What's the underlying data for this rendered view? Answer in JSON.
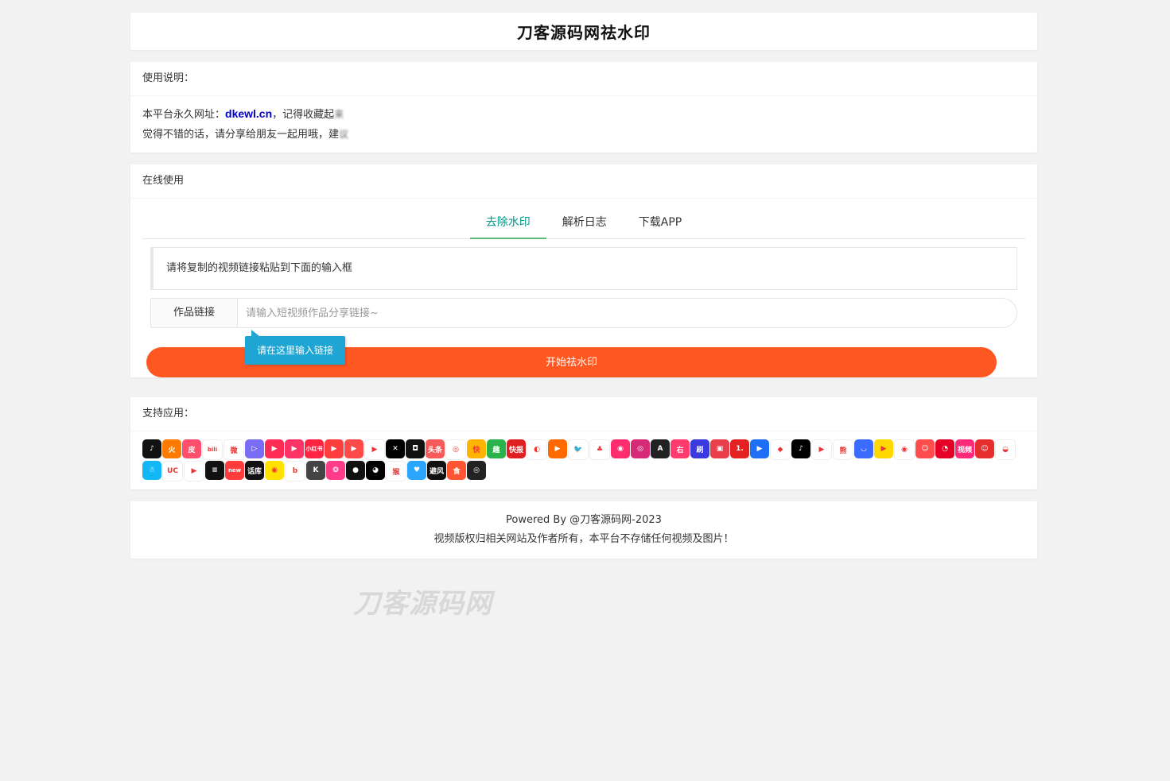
{
  "header": {
    "title": "刀客源码网祛水印"
  },
  "usage": {
    "heading": "使用说明：",
    "line1_prefix": "本平台永久网址：",
    "domain": "dkewl.cn",
    "line1_mid": "，记得收藏起",
    "line1_blur": "来",
    "line2_prefix": "觉得不错的话，请分享给朋友一起用哦，建",
    "line2_blur": "议"
  },
  "online": {
    "heading": "在线使用",
    "tabs": [
      {
        "label": "去除水印",
        "active": true
      },
      {
        "label": "解析日志",
        "active": false
      },
      {
        "label": "下载APP",
        "active": false
      }
    ],
    "notice": "请将复制的视频链接粘贴到下面的输入框",
    "input_label": "作品链接",
    "input_placeholder": "请输入短视频作品分享链接~",
    "input_value": "",
    "tooltip": "请在这里输入链接",
    "submit_label": "开始祛水印"
  },
  "supported": {
    "heading": "支持应用：",
    "icons": [
      {
        "name": "douyin-icon",
        "color": "#111111",
        "glyph": "♪"
      },
      {
        "name": "huoshan-icon",
        "color": "#ff7a00",
        "glyph": "火"
      },
      {
        "name": "pipixia-icon",
        "color": "#ff4f6d",
        "glyph": "皮"
      },
      {
        "name": "bilibili-icon",
        "color": "#ffffff",
        "glyph": "bili"
      },
      {
        "name": "weibo-icon",
        "color": "#ffffff",
        "glyph": "微"
      },
      {
        "name": "weishi-icon",
        "color": "#7b6cf6",
        "glyph": "▷"
      },
      {
        "name": "quanmin-icon",
        "color": "#ff2d55",
        "glyph": "▶"
      },
      {
        "name": "kuai-video-icon",
        "color": "#ff3366",
        "glyph": "▶"
      },
      {
        "name": "xiaohongshu-icon",
        "color": "#ff2442",
        "glyph": "小红书"
      },
      {
        "name": "haokan-icon",
        "color": "#ff3d3d",
        "glyph": "▶"
      },
      {
        "name": "xigua-icon",
        "color": "#ff4a4a",
        "glyph": "▶"
      },
      {
        "name": "youku-icon",
        "color": "#ffffff",
        "glyph": "▶"
      },
      {
        "name": "jianying-icon",
        "color": "#000000",
        "glyph": "✕"
      },
      {
        "name": "kuaishou-cam-icon",
        "color": "#111111",
        "glyph": "◘"
      },
      {
        "name": "toutiao-icon",
        "color": "#f85959",
        "glyph": "头条"
      },
      {
        "name": "meipai-icon",
        "color": "#ffffff",
        "glyph": "◎"
      },
      {
        "name": "kuai-icon",
        "color": "#ffb400",
        "glyph": "快"
      },
      {
        "name": "qutoutiao-icon",
        "color": "#2ab34a",
        "glyph": "趣"
      },
      {
        "name": "kuaibao-icon",
        "color": "#e02020",
        "glyph": "快报"
      },
      {
        "name": "weishi2-icon",
        "color": "#ffffff",
        "glyph": "◐"
      },
      {
        "name": "ku-video-icon",
        "color": "#ff6a00",
        "glyph": "▶"
      },
      {
        "name": "twitter-icon",
        "color": "#ffffff",
        "glyph": "🐦"
      },
      {
        "name": "lvzhou-icon",
        "color": "#ffffff",
        "glyph": "♣"
      },
      {
        "name": "momo-icon",
        "color": "#ff2d6f",
        "glyph": "◉"
      },
      {
        "name": "instagram-icon",
        "color": "#d62976",
        "glyph": "◎"
      },
      {
        "name": "acfun-icon",
        "color": "#222222",
        "glyph": "A"
      },
      {
        "name": "zuiyou-icon",
        "color": "#ff3a6e",
        "glyph": "右"
      },
      {
        "name": "shua-icon",
        "color": "#3a3adf",
        "glyph": "刷"
      },
      {
        "name": "mei-video-icon",
        "color": "#e93e4b",
        "glyph": "▣"
      },
      {
        "name": "yidian-icon",
        "color": "#e52222",
        "glyph": "1."
      },
      {
        "name": "play-icon",
        "color": "#1e6ff5",
        "glyph": "▶"
      },
      {
        "name": "aiqiyi-icon",
        "color": "#ffffff",
        "glyph": "◆"
      },
      {
        "name": "tiktok-icon",
        "color": "#000000",
        "glyph": "♪"
      },
      {
        "name": "youtube-icon",
        "color": "#ffffff",
        "glyph": "▶"
      },
      {
        "name": "panda-icon",
        "color": "#ffffff",
        "glyph": "熊"
      },
      {
        "name": "soul-icon",
        "color": "#3b6cff",
        "glyph": "◡"
      },
      {
        "name": "xiaoying-icon",
        "color": "#ffd800",
        "glyph": "▶"
      },
      {
        "name": "eye-icon",
        "color": "#ffffff",
        "glyph": "◉"
      },
      {
        "name": "face-icon",
        "color": "#ff4d4d",
        "glyph": "☺"
      },
      {
        "name": "netease-icon",
        "color": "#e60026",
        "glyph": "◔"
      },
      {
        "name": "shipin-icon",
        "color": "#ff2a7a",
        "glyph": "视频"
      },
      {
        "name": "meme-icon",
        "color": "#e62e2e",
        "glyph": "☺"
      },
      {
        "name": "bowl-icon",
        "color": "#ffffff",
        "glyph": "◒"
      },
      {
        "name": "qq-icon",
        "color": "#12b7f5",
        "glyph": "☃"
      },
      {
        "name": "uc-icon",
        "color": "#ffffff",
        "glyph": "UC"
      },
      {
        "name": "tengxun-icon",
        "color": "#ffffff",
        "glyph": "▶"
      },
      {
        "name": "stripes-icon",
        "color": "#111111",
        "glyph": "≡"
      },
      {
        "name": "new-icon",
        "color": "#ff3b3b",
        "glyph": "new"
      },
      {
        "name": "tuku-icon",
        "color": "#111111",
        "glyph": "话库"
      },
      {
        "name": "yellow-icon",
        "color": "#ffe200",
        "glyph": "◉"
      },
      {
        "name": "b-icon",
        "color": "#ffffff",
        "glyph": "b"
      },
      {
        "name": "k-icon",
        "color": "#444444",
        "glyph": "K"
      },
      {
        "name": "pink-icon",
        "color": "#ff3b8a",
        "glyph": "❂"
      },
      {
        "name": "cyan-icon",
        "color": "#111111",
        "glyph": "●"
      },
      {
        "name": "mouth-icon",
        "color": "#000000",
        "glyph": "◕"
      },
      {
        "name": "monkey-icon",
        "color": "#ffffff",
        "glyph": "猴"
      },
      {
        "name": "heart-icon",
        "color": "#2aa6ff",
        "glyph": "♥"
      },
      {
        "name": "bifeng-icon",
        "color": "#111111",
        "glyph": "避风"
      },
      {
        "name": "shi-icon",
        "color": "#ff5533",
        "glyph": "食"
      },
      {
        "name": "ring-icon",
        "color": "#222222",
        "glyph": "◎"
      }
    ]
  },
  "footer": {
    "line1": "Powered By @刀客源码网-2023",
    "line2": "视频版权归相关网站及作者所有，本平台不存储任何视频及图片！"
  },
  "watermark": {
    "text": "刀客源码网"
  },
  "colors": {
    "accent": "#009688",
    "tab_underline": "#5fb878",
    "button": "#ff5722",
    "tooltip": "#1ea5d3",
    "link": "#0000cc"
  }
}
